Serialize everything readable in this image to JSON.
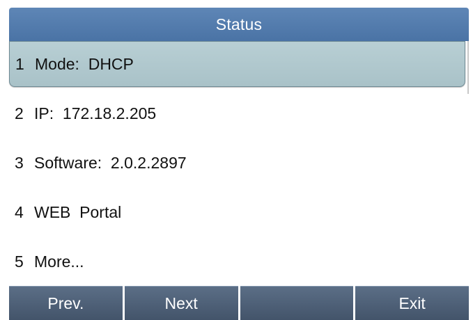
{
  "header": {
    "title": "Status"
  },
  "menu": {
    "items": [
      {
        "num": "1",
        "label": "Mode:  DHCP",
        "selected": true
      },
      {
        "num": "2",
        "label": "IP:  172.18.2.205",
        "selected": false
      },
      {
        "num": "3",
        "label": "Software:  2.0.2.2897",
        "selected": false
      },
      {
        "num": "4",
        "label": "WEB  Portal",
        "selected": false
      },
      {
        "num": "5",
        "label": "More...",
        "selected": false
      }
    ]
  },
  "softkeys": {
    "prev_label": "Prev.",
    "next_label": "Next",
    "blank_label": "",
    "exit_label": "Exit"
  },
  "colors": {
    "title_bar": "#4f78aa",
    "selected_row": "#b1c8ce",
    "softkey": "#4f6078"
  }
}
